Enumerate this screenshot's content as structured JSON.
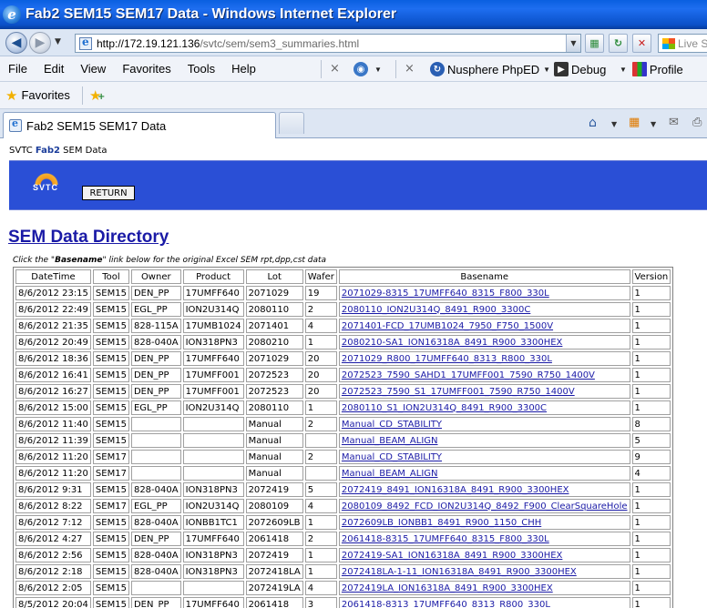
{
  "window": {
    "title": "Fab2 SEM15 SEM17 Data - Windows Internet Explorer"
  },
  "address_bar": {
    "url_prefix": "http://172.19.121.136",
    "url_path": "/svtc/sem/sem3_summaries.html",
    "search_placeholder": "Live S"
  },
  "menu": {
    "items": [
      "File",
      "Edit",
      "View",
      "Favorites",
      "Tools",
      "Help"
    ],
    "tools": {
      "phped": "Nusphere PhpED",
      "debug": "Debug",
      "profile": "Profile"
    }
  },
  "favorites_bar": {
    "label": "Favorites"
  },
  "tabs": [
    {
      "label": "Fab2 SEM15 SEM17 Data"
    }
  ],
  "page": {
    "site_prefix": "SVTC ",
    "site_bold": "Fab2",
    "site_suffix": " SEM Data",
    "logo_text": "SVTC",
    "return_label": "RETURN",
    "title": "SEM Data Directory",
    "hint_prefix": "Click the \"",
    "hint_bold": "Basename",
    "hint_suffix": "\" link below for the original Excel SEM rpt,dpp,cst data",
    "columns": [
      "DateTime",
      "Tool",
      "Owner",
      "Product",
      "Lot",
      "Wafer",
      "Basename",
      "Version"
    ],
    "rows": [
      [
        "8/6/2012 23:15",
        "SEM15",
        "DEN_PP",
        "17UMFF640",
        "2071029",
        "19",
        "2071029-8315_17UMFF640_8315_F800_330L",
        "1"
      ],
      [
        "8/6/2012 22:49",
        "SEM15",
        "EGL_PP",
        "ION2U314Q",
        "2080110",
        "2",
        "2080110_ION2U314Q_8491_R900_3300C",
        "1"
      ],
      [
        "8/6/2012 21:35",
        "SEM15",
        "828-115A",
        "17UMB1024",
        "2071401",
        "4",
        "2071401-FCD_17UMB1024_7950_F750_1500V",
        "1"
      ],
      [
        "8/6/2012 20:49",
        "SEM15",
        "828-040A",
        "ION318PN3",
        "2080210",
        "1",
        "2080210-SA1_ION16318A_8491_R900_3300HEX",
        "1"
      ],
      [
        "8/6/2012 18:36",
        "SEM15",
        "DEN_PP",
        "17UMFF640",
        "2071029",
        "20",
        "2071029_R800_17UMFF640_8313_R800_330L",
        "1"
      ],
      [
        "8/6/2012 16:41",
        "SEM15",
        "DEN_PP",
        "17UMFF001",
        "2072523",
        "20",
        "2072523_7590_SAHD1_17UMFF001_7590_R750_1400V",
        "1"
      ],
      [
        "8/6/2012 16:27",
        "SEM15",
        "DEN_PP",
        "17UMFF001",
        "2072523",
        "20",
        "2072523_7590_S1_17UMFF001_7590_R750_1400V",
        "1"
      ],
      [
        "8/6/2012 15:00",
        "SEM15",
        "EGL_PP",
        "ION2U314Q",
        "2080110",
        "1",
        "2080110_S1_ION2U314Q_8491_R900_3300C",
        "1"
      ],
      [
        "8/6/2012 11:40",
        "SEM15",
        "",
        "",
        "Manual",
        "2",
        "Manual_CD_STABILITY",
        "8"
      ],
      [
        "8/6/2012 11:39",
        "SEM15",
        "",
        "",
        "Manual",
        "",
        "Manual_BEAM_ALIGN",
        "5"
      ],
      [
        "8/6/2012 11:20",
        "SEM17",
        "",
        "",
        "Manual",
        "2",
        "Manual_CD_STABILITY",
        "9"
      ],
      [
        "8/6/2012 11:20",
        "SEM17",
        "",
        "",
        "Manual",
        "",
        "Manual_BEAM_ALIGN",
        "4"
      ],
      [
        "8/6/2012 9:31",
        "SEM15",
        "828-040A",
        "ION318PN3",
        "2072419",
        "5",
        "2072419_8491_ION16318A_8491_R900_3300HEX",
        "1"
      ],
      [
        "8/6/2012 8:22",
        "SEM17",
        "EGL_PP",
        "ION2U314Q",
        "2080109",
        "4",
        "2080109_8492_FCD_ION2U314Q_8492_F900_ClearSquareHole",
        "1"
      ],
      [
        "8/6/2012 7:12",
        "SEM15",
        "828-040A",
        "IONBB1TC1",
        "2072609LB",
        "1",
        "2072609LB_IONBB1_8491_R900_1150_CHH",
        "1"
      ],
      [
        "8/6/2012 4:27",
        "SEM15",
        "DEN_PP",
        "17UMFF640",
        "2061418",
        "2",
        "2061418-8315_17UMFF640_8315_F800_330L",
        "1"
      ],
      [
        "8/6/2012 2:56",
        "SEM15",
        "828-040A",
        "ION318PN3",
        "2072419",
        "1",
        "2072419-SA1_ION16318A_8491_R900_3300HEX",
        "1"
      ],
      [
        "8/6/2012 2:18",
        "SEM15",
        "828-040A",
        "ION318PN3",
        "2072418LA",
        "1",
        "2072418LA-1-11_ION16318A_8491_R900_3300HEX",
        "1"
      ],
      [
        "8/6/2012 2:05",
        "SEM15",
        "",
        "",
        "2072419LA",
        "4",
        "2072419LA_ION16318A_8491_R900_3300HEX",
        "1"
      ],
      [
        "8/5/2012 20:04",
        "SEM15",
        "DEN_PP",
        "17UMFF640",
        "2061418",
        "3",
        "2061418-8313_17UMFF640_8313_R800_330L",
        "1"
      ]
    ]
  }
}
